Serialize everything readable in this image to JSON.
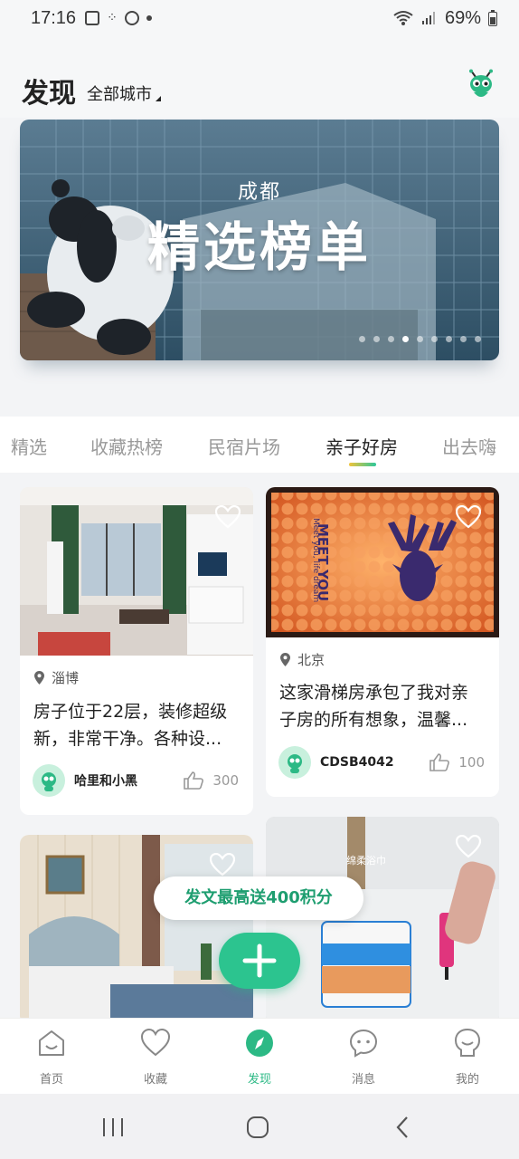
{
  "status": {
    "time": "17:16",
    "battery": "69%"
  },
  "header": {
    "title": "发现",
    "city": "全部城市"
  },
  "banner": {
    "city": "成都",
    "title": "精选榜单",
    "active_dot": 3,
    "dot_count": 9
  },
  "tabs": [
    {
      "label": "精选",
      "active": false
    },
    {
      "label": "收藏热榜",
      "active": false
    },
    {
      "label": "民宿片场",
      "active": false
    },
    {
      "label": "亲子好房",
      "active": true
    },
    {
      "label": "出去嗨",
      "active": false
    }
  ],
  "cards": [
    {
      "location": "淄博",
      "desc_line1": "房子位于22层，装修超级",
      "desc_line2": "新，非常干净。各种设...",
      "author": "哈里和小黑",
      "likes": "300"
    },
    {
      "location": "北京",
      "desc_line1": "这家滑梯房承包了我对亲",
      "desc_line2": "子房的所有想象，温馨...",
      "author": "CDSB4042",
      "likes": "100"
    }
  ],
  "image_text": {
    "wall_sign_1": "MEET YOU",
    "wall_sign_2": "Meet you, life dream",
    "towel_pack": "绵柔浴巾"
  },
  "promo": {
    "label": "发文最高送400积分"
  },
  "bottom_nav": [
    {
      "label": "首页",
      "icon": "home-icon"
    },
    {
      "label": "收藏",
      "icon": "heart-icon"
    },
    {
      "label": "发现",
      "icon": "compass-icon"
    },
    {
      "label": "消息",
      "icon": "chat-icon"
    },
    {
      "label": "我的",
      "icon": "profile-icon"
    }
  ],
  "colors": {
    "accent": "#2cb985",
    "promo_text": "#1e9e70"
  }
}
